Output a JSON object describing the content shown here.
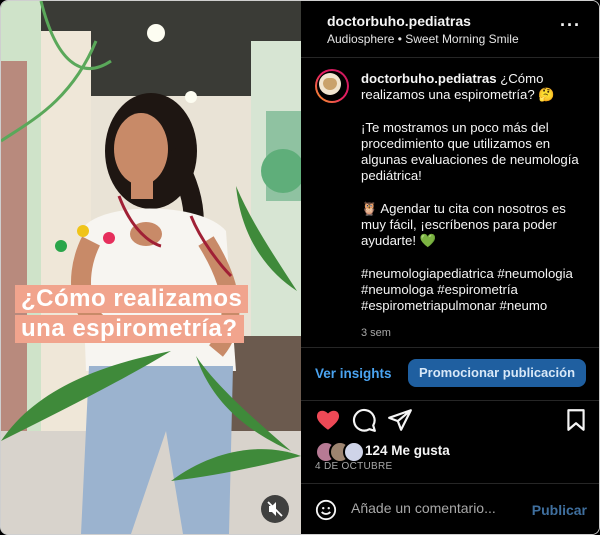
{
  "post": {
    "username": "doctorbuho.pediatras",
    "audio": "Audiosphere • Sweet Morning Smile",
    "more_icon": "ellipsis-icon"
  },
  "media": {
    "overlay_line1": "¿Cómo realizamos",
    "overlay_line2": "una espirometría?",
    "mute_icon": "muted-speaker-icon"
  },
  "caption": {
    "username": "doctorbuho.pediatras",
    "intro": "¿Cómo realizamos una espirometría? 🤔",
    "para1": "¡Te mostramos un poco más del procedimiento que utilizamos en algunas evaluaciones de neumología pediátrica!",
    "para2": "🦉 Agendar tu cita con nosotros es muy fácil, ¡escríbenos para poder ayudarte! 💚",
    "hashtags": "#neumologiapediatrica #neumologia #neumologa #espirometría #espirometriapulmonar #neumo",
    "time": "3 sem"
  },
  "actions": {
    "insights_label": "Ver insights",
    "promote_label": "Promocionar publicación",
    "likes": "124 Me gusta",
    "date": "4 DE OCTUBRE"
  },
  "comment": {
    "placeholder": "Añade un comentario...",
    "publish_label": "Publicar"
  },
  "colors": {
    "accent": "#4aa3f0",
    "promote_bg": "#1f5fa0",
    "like": "#ed4956",
    "overlay_bg": "#f1a48d"
  }
}
